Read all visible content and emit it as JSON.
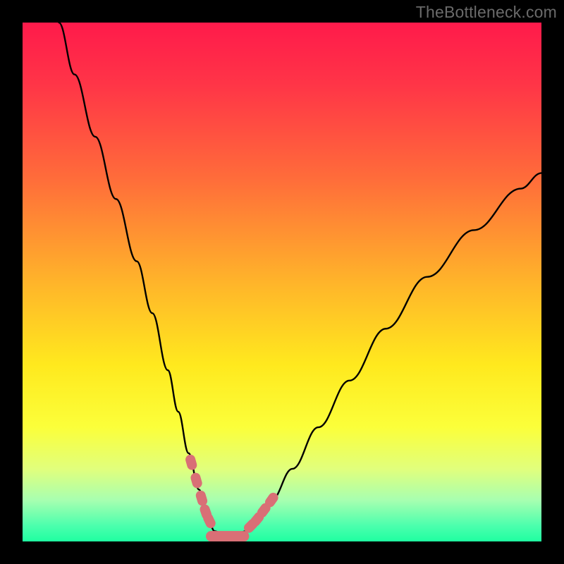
{
  "watermark": "TheBottleneck.com",
  "gradient": {
    "stops": [
      {
        "offset": 0.0,
        "color": "#ff1a4b"
      },
      {
        "offset": 0.12,
        "color": "#ff3547"
      },
      {
        "offset": 0.3,
        "color": "#ff6c3a"
      },
      {
        "offset": 0.5,
        "color": "#ffb42a"
      },
      {
        "offset": 0.66,
        "color": "#ffe91e"
      },
      {
        "offset": 0.78,
        "color": "#fbff3a"
      },
      {
        "offset": 0.86,
        "color": "#e1ff7c"
      },
      {
        "offset": 0.92,
        "color": "#a8ffb0"
      },
      {
        "offset": 0.97,
        "color": "#4bffad"
      },
      {
        "offset": 1.0,
        "color": "#1fffa1"
      }
    ]
  },
  "accent_color": "#d96f76",
  "curve_color": "#000000",
  "chart_data": {
    "type": "line",
    "title": "",
    "xlabel": "",
    "ylabel": "",
    "xlim": [
      0,
      100
    ],
    "ylim": [
      0,
      100
    ],
    "series": [
      {
        "name": "curve",
        "x": [
          7,
          10,
          14,
          18,
          22,
          25,
          28,
          30,
          32,
          34,
          35.5,
          37,
          39,
          41,
          43,
          45,
          48,
          52,
          57,
          63,
          70,
          78,
          87,
          96,
          100
        ],
        "values": [
          100,
          90,
          78,
          66,
          54,
          44,
          33,
          25,
          17,
          10,
          5,
          2,
          1,
          1,
          2,
          4,
          8,
          14,
          22,
          31,
          41,
          51,
          60,
          68,
          71
        ]
      }
    ],
    "marker_band_y": [
      7,
      14
    ],
    "minimum_x_range": [
      36,
      43
    ],
    "markers_left_x": [
      32.5,
      33.5,
      34.5,
      35.3,
      36.0
    ],
    "markers_right_x": [
      44.0,
      45.2,
      46.5,
      48.0
    ]
  }
}
